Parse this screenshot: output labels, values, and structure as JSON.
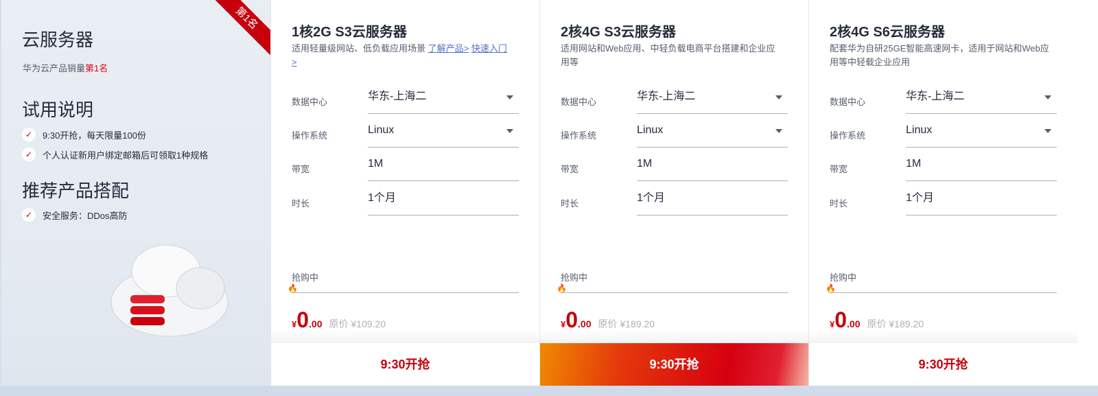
{
  "left": {
    "ribbon": "第1名",
    "title": "云服务器",
    "subtitle": "华为云产品销量",
    "subtitle_highlight": "第1名",
    "trial_title": "试用说明",
    "trial_items": [
      "9:30开抢，每天限量100份",
      "个人认证新用户绑定邮箱后可领取1种规格"
    ],
    "recommend_title": "推荐产品搭配",
    "recommend_items": [
      "安全服务：DDos高防"
    ]
  },
  "labels": {
    "datacenter": "数据中心",
    "os": "操作系统",
    "bandwidth": "带宽",
    "duration": "时长",
    "grabbing": "抢购中",
    "currency": "¥",
    "orig_prefix": "原价"
  },
  "cards": [
    {
      "title": "1核2G S3云服务器",
      "desc": "适用轻量级网站、低负载应用场景 ",
      "link1": "了解产品>",
      "link2": "快速入门>",
      "datacenter": "华东-上海二",
      "os": "Linux",
      "bandwidth": "1M",
      "duration": "1个月",
      "progress": 0,
      "price_int": "0",
      "price_dec": ".00",
      "orig_price": "¥109.20",
      "button": "9:30开抢"
    },
    {
      "title": "2核4G S3云服务器",
      "desc": "适用网站和Web应用、中轻负载电商平台搭建和企业应用等",
      "datacenter": "华东-上海二",
      "os": "Linux",
      "bandwidth": "1M",
      "duration": "1个月",
      "progress": 0,
      "price_int": "0",
      "price_dec": ".00",
      "orig_price": "¥189.20",
      "button": "9:30开抢"
    },
    {
      "title": "2核4G S6云服务器",
      "desc": "配套华为自研25GE智能高速网卡，适用于网站和Web应用等中轻载企业应用",
      "datacenter": "华东-上海二",
      "os": "Linux",
      "bandwidth": "1M",
      "duration": "1个月",
      "progress": 0,
      "price_int": "0",
      "price_dec": ".00",
      "orig_price": "¥189.20",
      "button": "9:30开抢"
    }
  ]
}
